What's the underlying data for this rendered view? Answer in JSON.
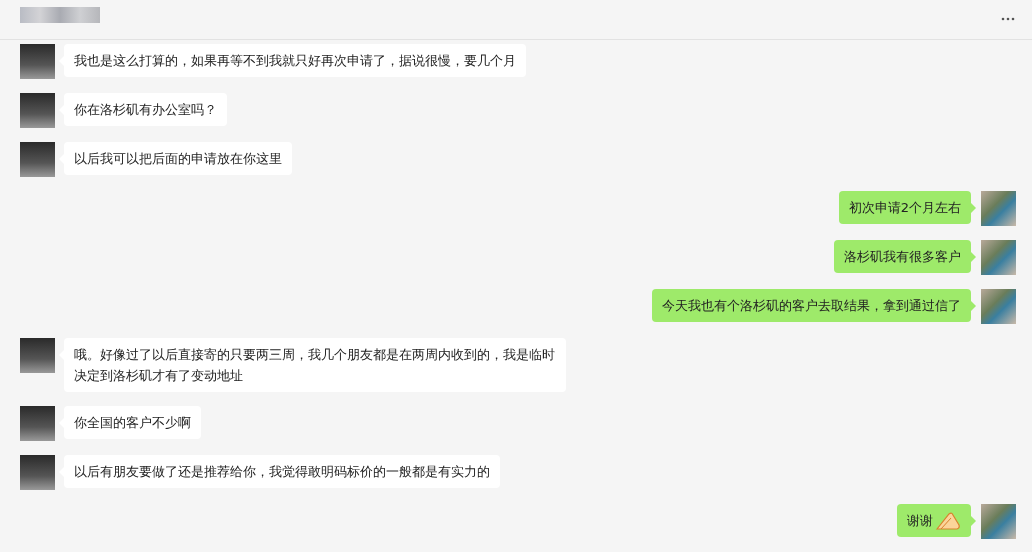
{
  "messages": [
    {
      "kind": "received",
      "text": "我也是这么打算的，如果再等不到我就只好再次申请了，据说很慢，要几个月",
      "has_emoji": false
    },
    {
      "kind": "received",
      "text": "你在洛杉矶有办公室吗？",
      "has_emoji": false
    },
    {
      "kind": "received",
      "text": "以后我可以把后面的申请放在你这里",
      "has_emoji": false
    },
    {
      "kind": "sent",
      "text": "初次申请2个月左右",
      "has_emoji": false
    },
    {
      "kind": "sent",
      "text": "洛杉矶我有很多客户",
      "has_emoji": false
    },
    {
      "kind": "sent",
      "text": "今天我也有个洛杉矶的客户去取结果，拿到通过信了",
      "has_emoji": false
    },
    {
      "kind": "received",
      "text": "哦。好像过了以后直接寄的只要两三周，我几个朋友都是在两周内收到的，我是临时决定到洛杉矶才有了变动地址",
      "has_emoji": false
    },
    {
      "kind": "received",
      "text": "你全国的客户不少啊",
      "has_emoji": false
    },
    {
      "kind": "received",
      "text": "以后有朋友要做了还是推荐给你，我觉得敢明码标价的一般都是有实力的",
      "has_emoji": false
    },
    {
      "kind": "sent",
      "text": "谢谢",
      "has_emoji": true
    }
  ]
}
